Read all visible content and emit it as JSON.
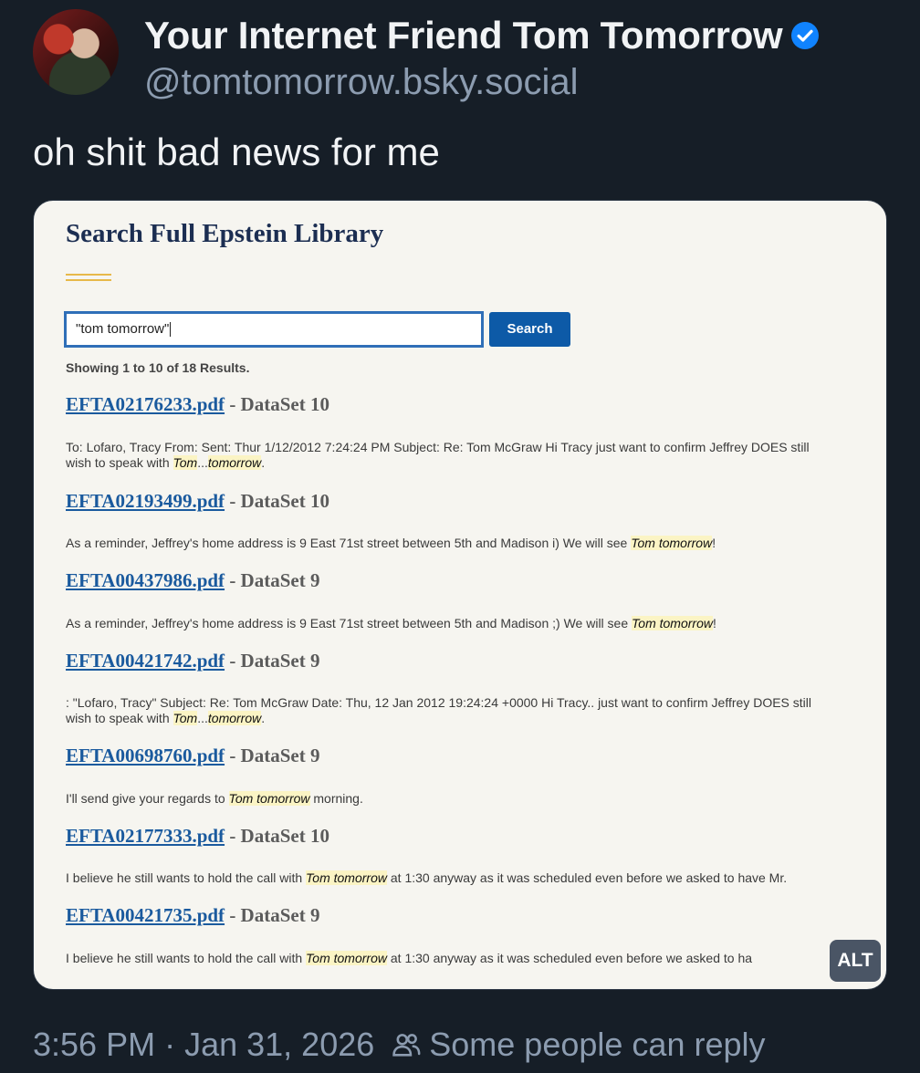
{
  "post": {
    "display_name": "Your Internet Friend Tom Tomorrow",
    "handle": "@tomtomorrow.bsky.social",
    "text": "oh shit bad news for me",
    "time": "3:56 PM",
    "separator": "·",
    "date": "Jan 31, 2026",
    "reply_setting": "Some people can reply",
    "alt_label": "ALT"
  },
  "screenshot": {
    "title": "Search Full Epstein Library",
    "search_value": "\"tom tomorrow\"",
    "search_button": "Search",
    "showing": "Showing 1 to 10 of 18 Results.",
    "results": [
      {
        "file": "EFTA02176233.pdf",
        "dataset": " - DataSet 10",
        "line1_pre": "To: Lofaro, Tracy From: Sent: Thur 1/12/2012 7:24:24 PM Subject: Re: Tom McGraw Hi Tracy just want to confirm Jeffrey DOES still",
        "line2_pre": "wish to speak with ",
        "hl1": "Tom",
        "mid": "...",
        "hl2": "tomorrow",
        "post": "."
      },
      {
        "file": "EFTA02193499.pdf",
        "dataset": " - DataSet 10",
        "pre": "As a reminder, Jeffrey's home address is 9 East 71st street between 5th and Madison i) We will see ",
        "hl": "Tom tomorrow",
        "post": "!"
      },
      {
        "file": "EFTA00437986.pdf",
        "dataset": " - DataSet 9",
        "pre": "As a reminder, Jeffrey's home address is 9 East 71st street between 5th and Madison ;) We will see ",
        "hl": "Tom tomorrow",
        "post": "!"
      },
      {
        "file": "EFTA00421742.pdf",
        "dataset": " - DataSet 9",
        "line1_pre": ": \"Lofaro, Tracy\" Subject: Re: Tom McGraw Date: Thu, 12 Jan 2012 19:24:24 +0000 Hi Tracy.. just want to confirm Jeffrey DOES still",
        "line2_pre": "wish to speak with ",
        "hl1": "Tom",
        "mid": "...",
        "hl2": "tomorrow",
        "post": "."
      },
      {
        "file": "EFTA00698760.pdf",
        "dataset": " - DataSet 9",
        "pre": "I'll send give your regards to ",
        "hl": "Tom tomorrow",
        "post": " morning."
      },
      {
        "file": "EFTA02177333.pdf",
        "dataset": " - DataSet 10",
        "pre": "I believe he still wants to hold the call with ",
        "hl": "Tom tomorrow",
        "post": " at 1:30 anyway as it was scheduled even before we asked to have Mr."
      },
      {
        "file": "EFTA00421735.pdf",
        "dataset": " - DataSet 9",
        "pre": "I believe he still wants to hold the call with ",
        "hl": "Tom tomorrow",
        "post": " at 1:30 anyway as it was scheduled even before we asked to ha"
      }
    ]
  },
  "icons": {
    "verified": "verified-badge-icon",
    "people": "people-icon"
  },
  "colors": {
    "background": "#161e27",
    "verified": "#1083fe",
    "link": "#1a5a9e",
    "search_button": "#0d5aa7",
    "highlight": "#fbf4c4"
  }
}
